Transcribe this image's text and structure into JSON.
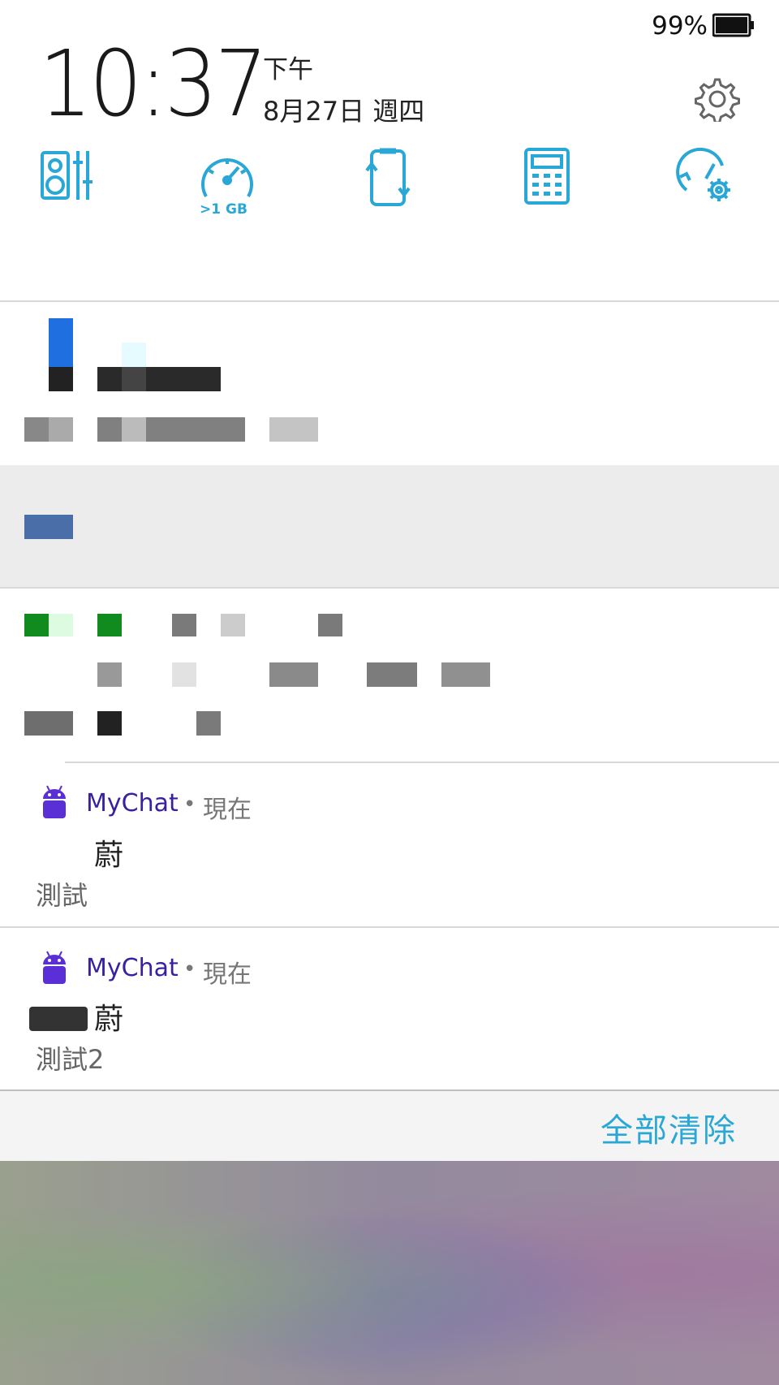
{
  "status_bar": {
    "battery_percent": "99%",
    "battery_level": 0.99
  },
  "header": {
    "time": "10:37",
    "ampm": "下午",
    "date": "8月27日 週四"
  },
  "quick_settings": [
    {
      "icon": "audio-equalizer-icon"
    },
    {
      "icon": "boost-speedometer-icon",
      "label": ">1 GB"
    },
    {
      "icon": "auto-rotate-icon"
    },
    {
      "icon": "calculator-icon"
    },
    {
      "icon": "mobile-manager-icon"
    }
  ],
  "notifications": [
    {
      "app": "MyChat",
      "separator": "•",
      "time": "現在",
      "title": "蔚",
      "body": "測試"
    },
    {
      "app": "MyChat",
      "separator": "•",
      "time": "現在",
      "title": "蔚",
      "body": "測試2"
    }
  ],
  "footer": {
    "clear_all": "全部清除"
  },
  "colors": {
    "accent": "#29a7d6",
    "app_name": "#3a1fa0",
    "app_icon": "#5b2fd6"
  }
}
